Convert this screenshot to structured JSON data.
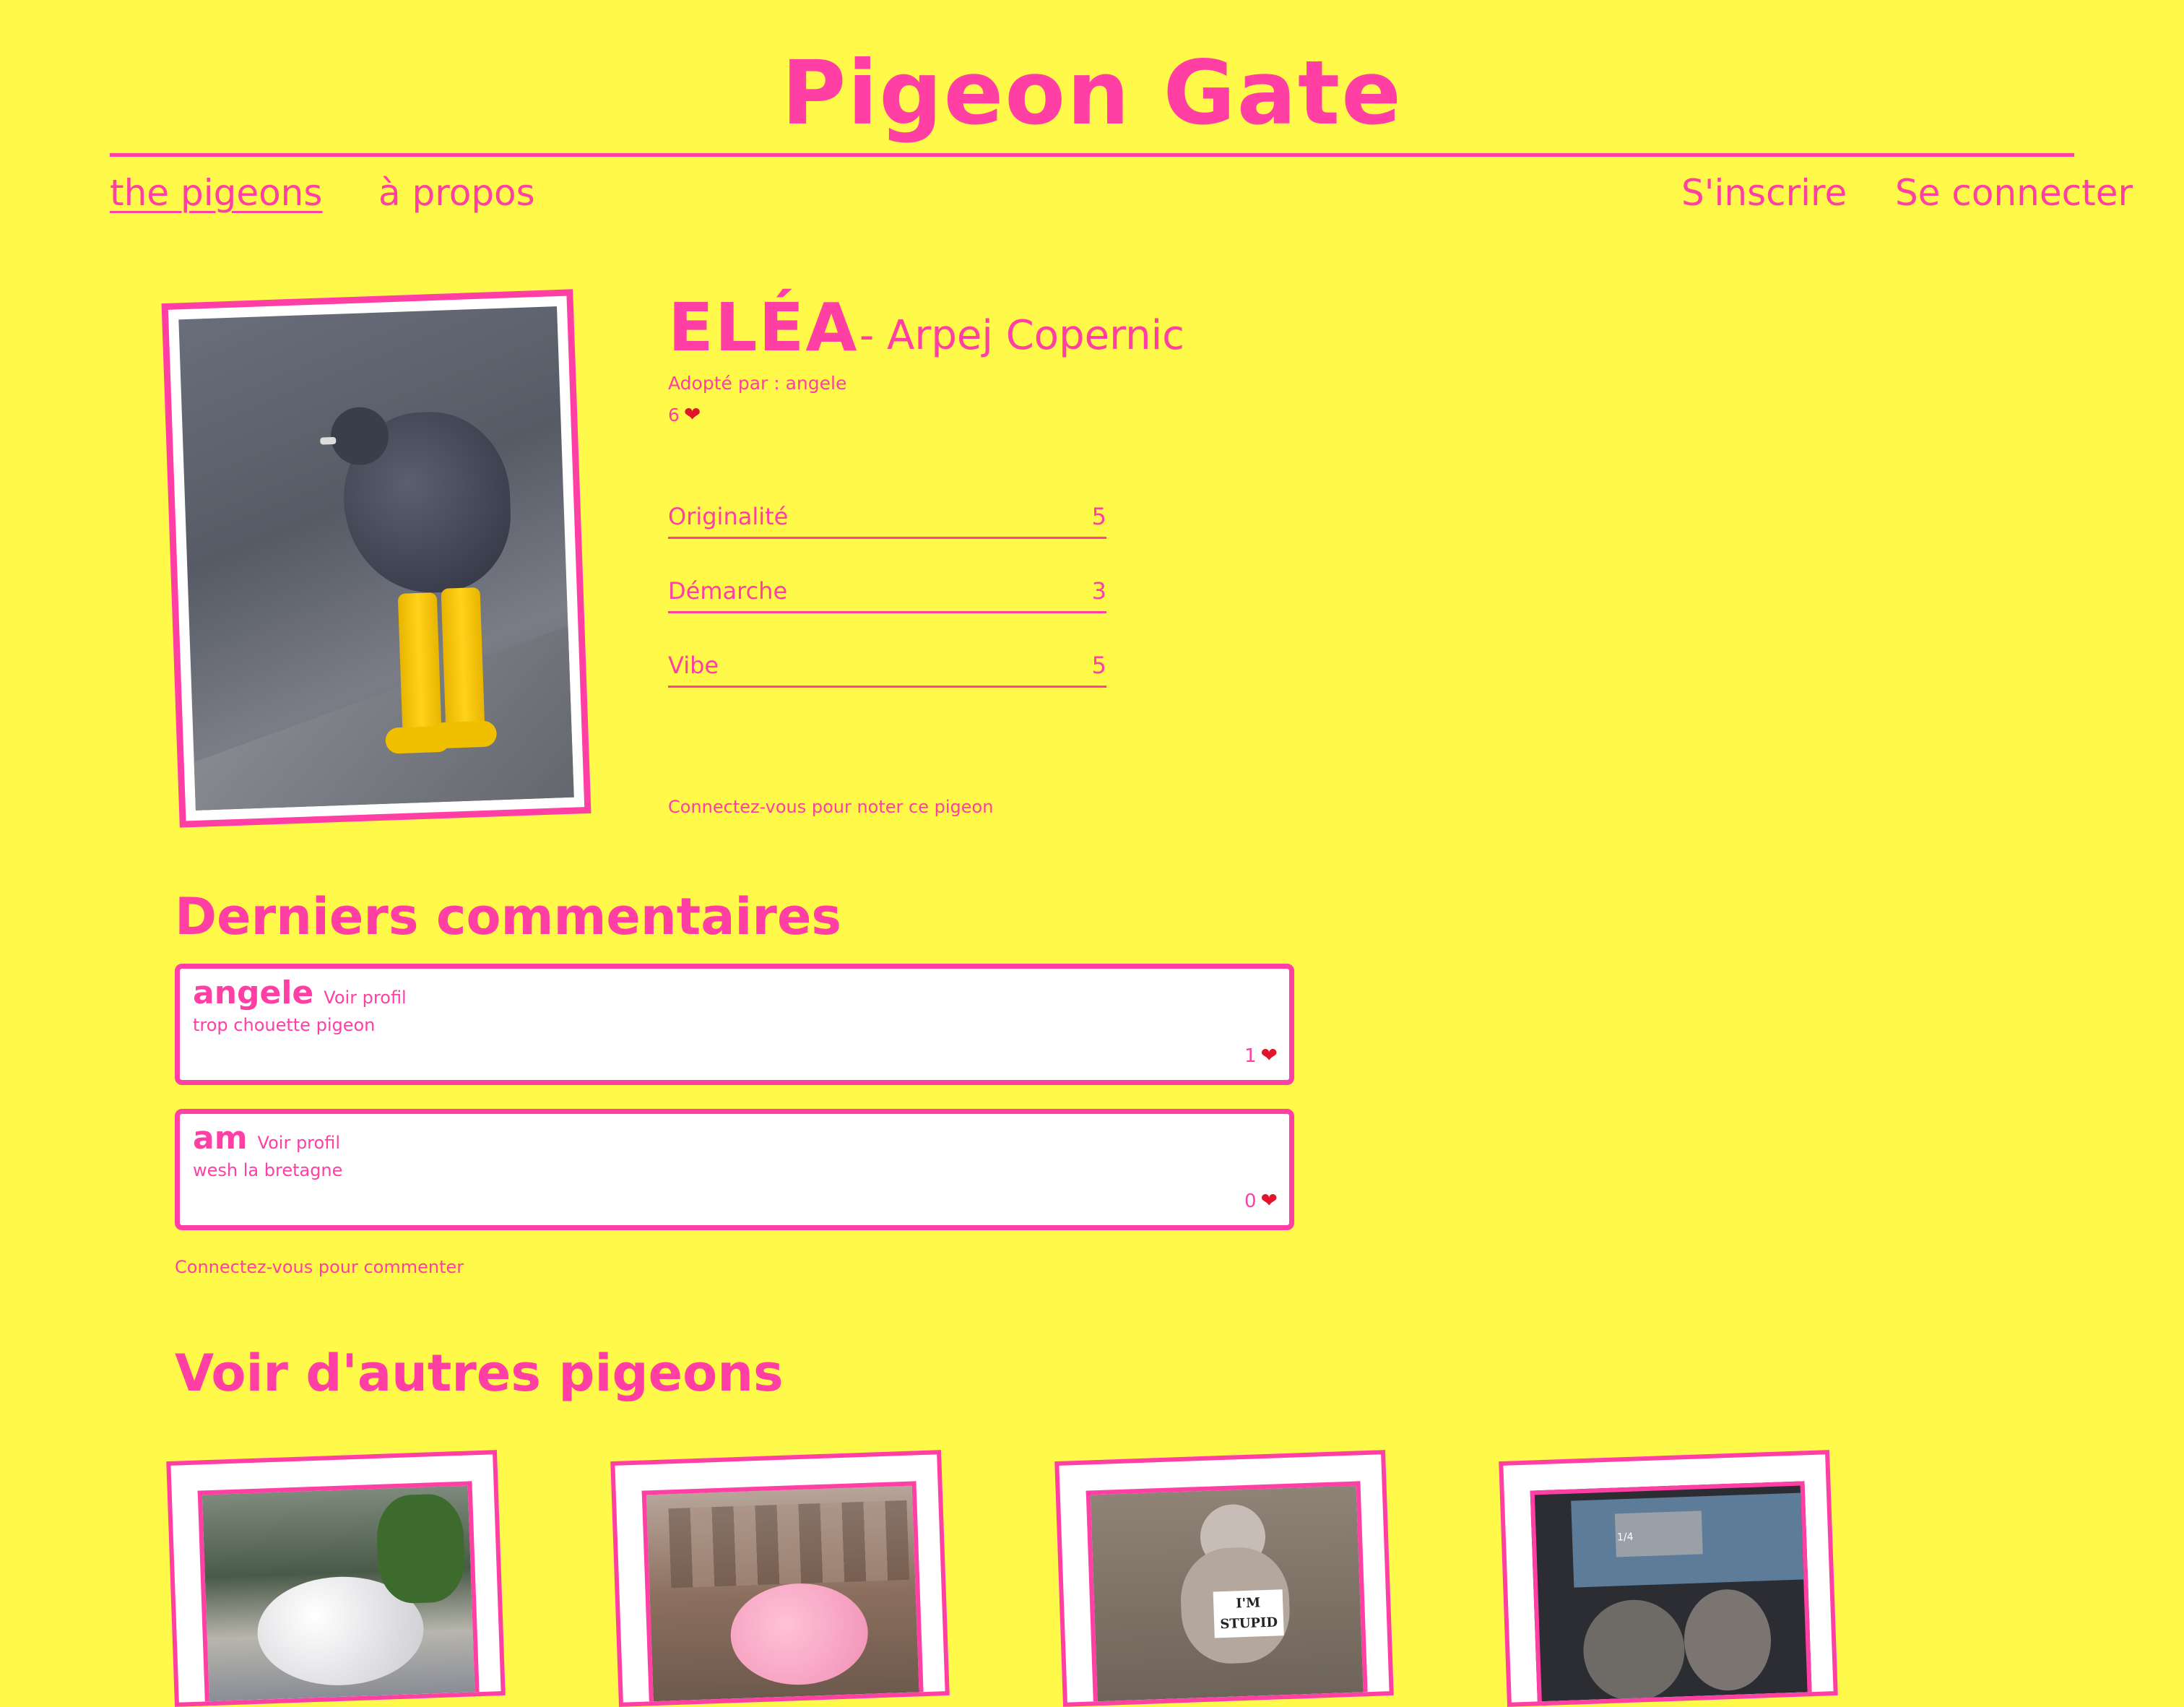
{
  "site": {
    "title": "Pigeon Gate"
  },
  "nav": {
    "left": [
      {
        "label": "the pigeons"
      },
      {
        "label": "à propos"
      }
    ],
    "right": [
      {
        "label": "S'inscrire"
      },
      {
        "label": "Se connecter"
      }
    ]
  },
  "pigeon": {
    "name": "ELÉA",
    "colony": "- Arpej Copernic",
    "adopted_by": "Adopté par : angele",
    "likes": "6",
    "scores": [
      {
        "label": "Originalité",
        "value": "5"
      },
      {
        "label": "Démarche",
        "value": "3"
      },
      {
        "label": "Vibe",
        "value": "5"
      }
    ],
    "rate_prompt": "Connectez-vous pour noter ce pigeon"
  },
  "comments": {
    "title": "Derniers commentaires",
    "items": [
      {
        "author": "angele",
        "profile_link": "Voir profil",
        "text": "trop chouette pigeon",
        "likes": "1"
      },
      {
        "author": "am",
        "profile_link": "Voir profil",
        "text": "wesh la bretagne",
        "likes": "0"
      }
    ],
    "prompt": "Connectez-vous pour commenter"
  },
  "others": {
    "title": "Voir d'autres pigeons",
    "cards": [
      {
        "icon": "white-dove-photo"
      },
      {
        "icon": "pink-pigeon-photo"
      },
      {
        "icon": "im-stupid-dove-photo",
        "sign": "I'M STUPID"
      },
      {
        "icon": "pigeons-computer-photo",
        "screen_label": "1/4"
      }
    ]
  },
  "colors": {
    "background": "#fff94a",
    "accent": "#ff3fa4",
    "heart": "#e0142b"
  }
}
